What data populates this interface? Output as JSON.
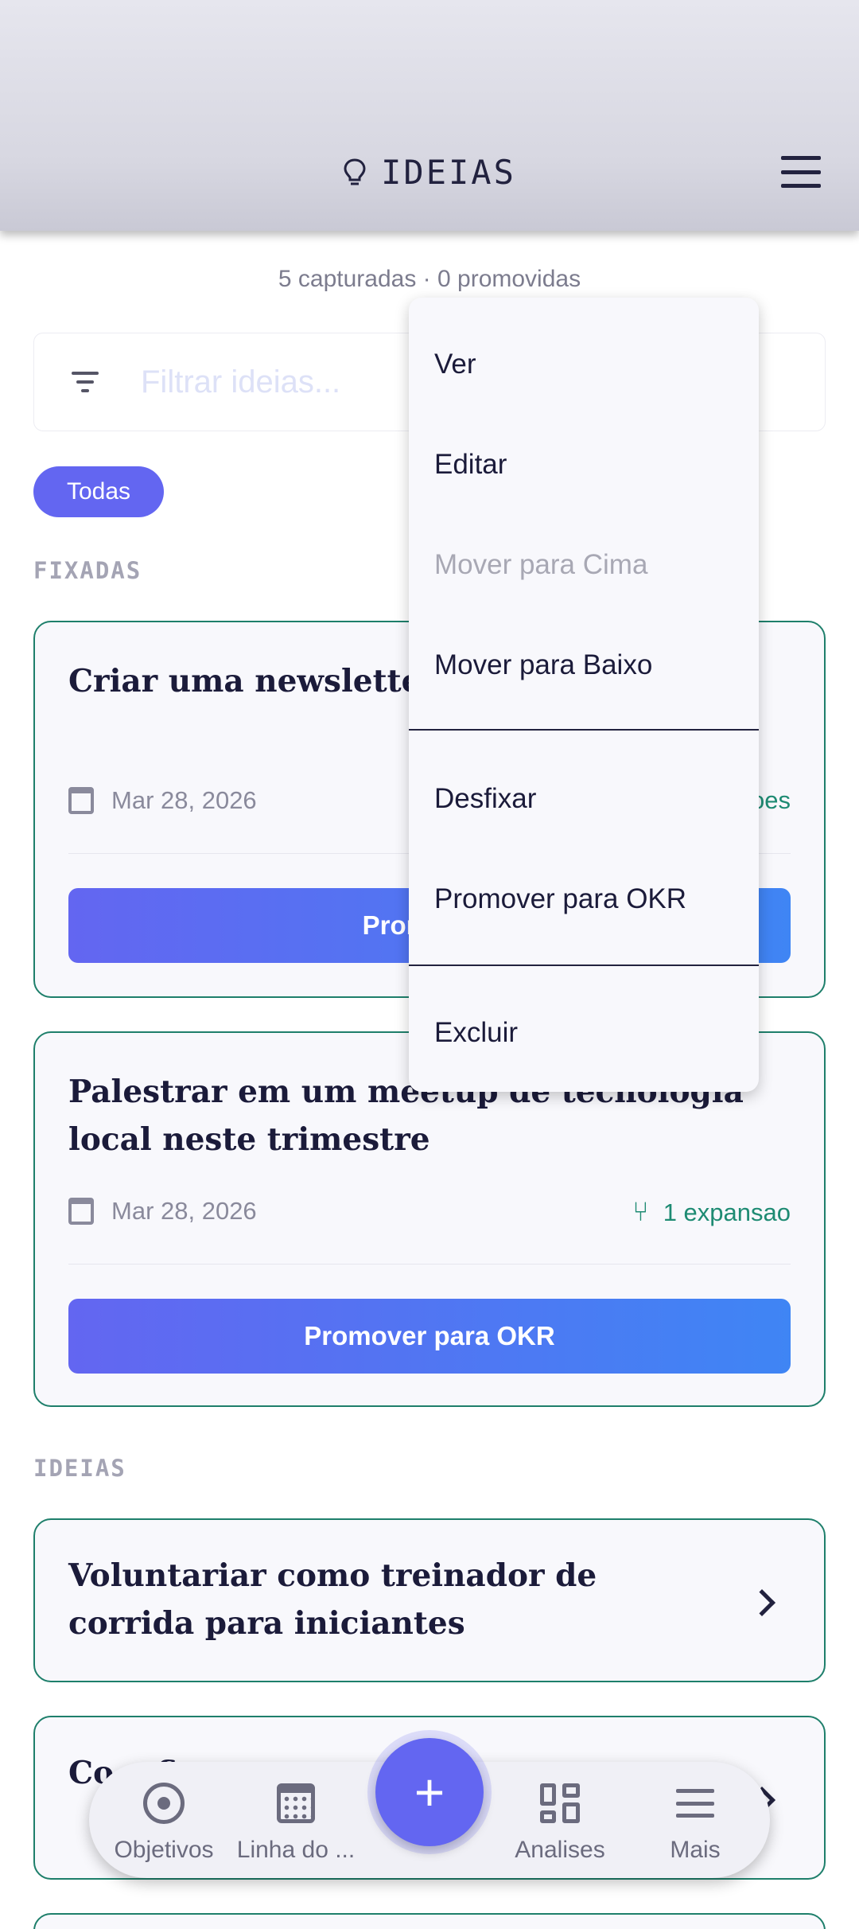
{
  "header": {
    "title": "IDEIAS",
    "icon": "lightbulb-icon"
  },
  "stats": "5 capturadas · 0 promovidas",
  "filter": {
    "placeholder": "Filtrar ideias..."
  },
  "chips": [
    {
      "label": "Todas",
      "selected": true
    }
  ],
  "sections": {
    "pinned": "FIXADAS",
    "ideas": "IDEIAS"
  },
  "pinned_cards": [
    {
      "title": "Criar uma newsletter ... to SaaS",
      "date": "Mar 28, 2026",
      "meta": "...oes",
      "button": "Promove..."
    },
    {
      "title": "Palestrar em um meetup de tecnologia local neste trimestre",
      "date": "Mar 28, 2026",
      "meta": "1 expansao",
      "button": "Promover para OKR"
    }
  ],
  "idea_cards": [
    {
      "title": "Voluntariar como treinador de corrida para iniciantes"
    },
    {
      "title": "Co... fi..."
    }
  ],
  "context_menu": {
    "items": [
      "Ver",
      "Editar",
      "Mover para Cima",
      "Mover para Baixo",
      "Desfixar",
      "Promover para OKR",
      "Excluir"
    ],
    "disabled": [
      "Mover para Cima"
    ]
  },
  "bottom_nav": {
    "items": [
      {
        "label": "Objetivos",
        "icon": "target-icon"
      },
      {
        "label": "Linha do ...",
        "icon": "calendar-icon"
      },
      {
        "label": "Analises",
        "icon": "dashboard-icon"
      },
      {
        "label": "Mais",
        "icon": "menu-icon"
      }
    ],
    "fab": "+"
  },
  "colors": {
    "accent": "#6366F1",
    "accent_end": "#3F85F4",
    "border": "#1E7F6B",
    "text": "#1B1B3A"
  }
}
